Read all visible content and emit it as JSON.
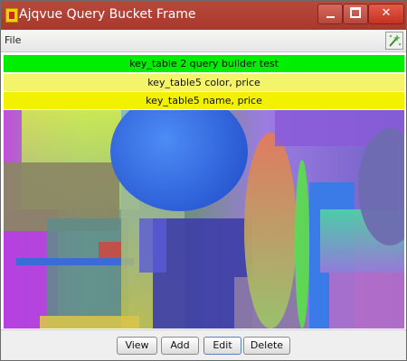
{
  "window": {
    "title": "Ajqvue Query Bucket Frame"
  },
  "menu": {
    "file": "File"
  },
  "query_rows": [
    {
      "label": "key_table 2 query builder test",
      "color": "#00ee00"
    },
    {
      "label": "key_table5 color, price",
      "color": "#f4f46a"
    },
    {
      "label": "key_table5 name, price",
      "color": "#f2f200"
    }
  ],
  "buttons": {
    "view": "View",
    "add": "Add",
    "edit": "Edit",
    "delete": "Delete"
  }
}
